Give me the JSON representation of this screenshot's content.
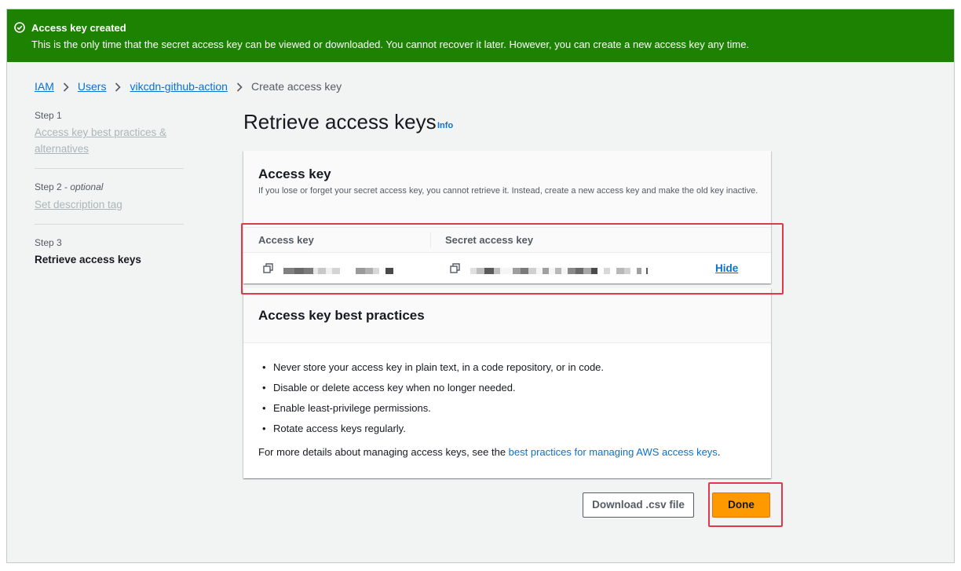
{
  "flash": {
    "title": "Access key created",
    "message": "This is the only time that the secret access key can be viewed or downloaded. You cannot recover it later. However, you can create a new access key any time."
  },
  "breadcrumb": [
    "IAM",
    "Users",
    "vikcdn-github-action",
    "Create access key"
  ],
  "steps": [
    {
      "label": "Step 1",
      "title": "Access key best practices & alternatives"
    },
    {
      "label": "Step 2",
      "label_suffix": "optional",
      "title": "Set description tag"
    },
    {
      "label": "Step 3",
      "title": "Retrieve access keys"
    }
  ],
  "page": {
    "title": "Retrieve access keys",
    "info": "Info"
  },
  "access_key_card": {
    "heading": "Access key",
    "description": "If you lose or forget your secret access key, you cannot retrieve it. Instead, create a new access key and make the old key inactive.",
    "columns": [
      "Access key",
      "Secret access key"
    ],
    "hide_label": "Hide"
  },
  "best_practices_card": {
    "heading": "Access key best practices",
    "items": [
      "Never store your access key in plain text, in a code repository, or in code.",
      "Disable or delete access key when no longer needed.",
      "Enable least-privilege permissions.",
      "Rotate access keys regularly."
    ],
    "more_prefix": "For more details about managing access keys, see the ",
    "more_link": "best practices for managing AWS access keys",
    "more_suffix": "."
  },
  "buttons": {
    "download": "Download .csv file",
    "done": "Done"
  },
  "colors": {
    "success": "#1d8102",
    "link": "#0972d3",
    "primary": "#ff9900",
    "highlight": "#e0394b"
  }
}
